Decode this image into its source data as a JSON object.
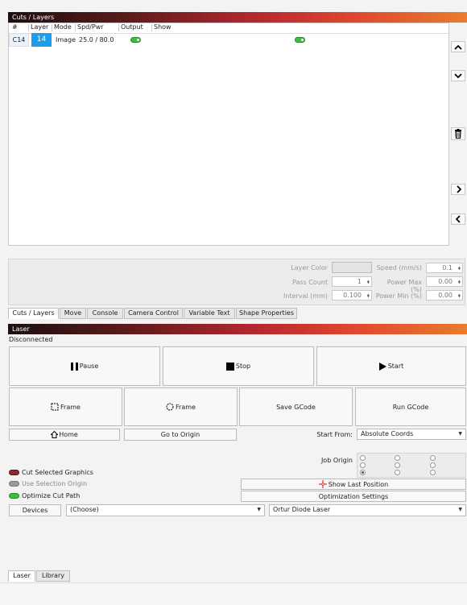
{
  "cuts_panel": {
    "title": "Cuts / Layers",
    "columns": [
      "#",
      "Layer",
      "Mode",
      "Spd/Pwr",
      "Output",
      "Show"
    ],
    "rows": [
      {
        "id": "C14",
        "layer": "14",
        "mode": "Image",
        "spd_pwr": "25.0 / 80.0"
      }
    ],
    "layer_color": "#1e9be9",
    "toggle_color": "#3bbf3b"
  },
  "settings": {
    "layer_color_label": "Layer Color",
    "speed_label": "Speed (mm/s)",
    "speed_value": "0.1",
    "pass_count_label": "Pass Count",
    "pass_count_value": "1",
    "power_max_label": "Power Max (%)",
    "power_max_value": "0.00",
    "interval_label": "Interval (mm)",
    "interval_value": "0.100",
    "power_min_label": "Power Min (%)",
    "power_min_value": "0.00"
  },
  "tabs_top": [
    "Cuts / Layers",
    "Move",
    "Console",
    "Camera Control",
    "Variable Text",
    "Shape Properties"
  ],
  "laser_panel": {
    "title": "Laser",
    "status": "Disconnected",
    "pause_label": "Pause",
    "stop_label": "Stop",
    "start_label": "Start",
    "frame1_label": "Frame",
    "frame2_label": "Frame",
    "save_gcode_label": "Save GCode",
    "run_gcode_label": "Run GCode",
    "home_label": "Home",
    "go_origin_label": "Go to Origin",
    "start_from_label": "Start From:",
    "start_from_value": "Absolute Coords",
    "job_origin_label": "Job Origin",
    "cut_selected_label": "Cut Selected Graphics",
    "use_selection_label": "Use Selection Origin",
    "optimize_label": "Optimize Cut Path",
    "show_last_label": "Show Last Position",
    "opt_settings_label": "Optimization Settings",
    "devices_label": "Devices",
    "device_choose": "(Choose)",
    "device_name": "Ortur Diode Laser"
  },
  "tabs_bottom": [
    "Laser",
    "Library"
  ]
}
